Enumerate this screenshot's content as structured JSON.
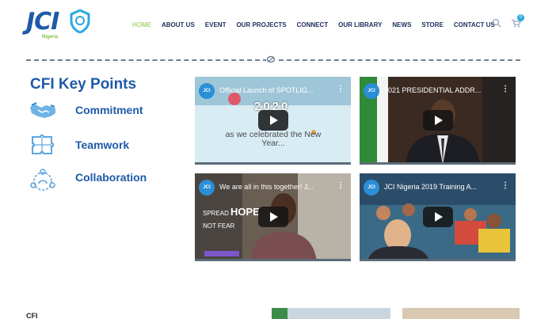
{
  "brand": {
    "logo_text": "JCI",
    "logo_subtitle": "Nigeria"
  },
  "nav": {
    "items": [
      "HOME",
      "ABOUT US",
      "EVENT",
      "OUR PROJECTS",
      "CONNECT",
      "OUR LIBRARY",
      "NEWS",
      "STORE",
      "CONTACT US"
    ],
    "active": "HOME",
    "cart_count": "0"
  },
  "key_points": {
    "title": "CFI Key Points",
    "items": [
      {
        "label": "Commitment",
        "icon": "handshake-icon"
      },
      {
        "label": "Teamwork",
        "icon": "puzzle-icon"
      },
      {
        "label": "Collaboration",
        "icon": "people-circle-icon"
      }
    ]
  },
  "videos": [
    {
      "channel": "JCI",
      "title": "Official Launch of SPOTLIG...",
      "overlay_year": "2020",
      "overlay_text": "as we celebrated the New Year..."
    },
    {
      "channel": "JCI",
      "title": "2021 PRESIDENTIAL ADDR..."
    },
    {
      "channel": "JCI",
      "title": "We are all in this together! J...",
      "overlay_spread": "SPREAD",
      "overlay_hope": "HOPE",
      "overlay_notfear": "NOT FEAR"
    },
    {
      "channel": "JCI",
      "title": "JCI Nigeria 2019 Training A..."
    }
  ],
  "bottom": {
    "label": "CFI"
  },
  "colors": {
    "brand_blue": "#1e5aa8",
    "accent_green": "#8cc63f",
    "nav_text": "#1b2f5a"
  }
}
